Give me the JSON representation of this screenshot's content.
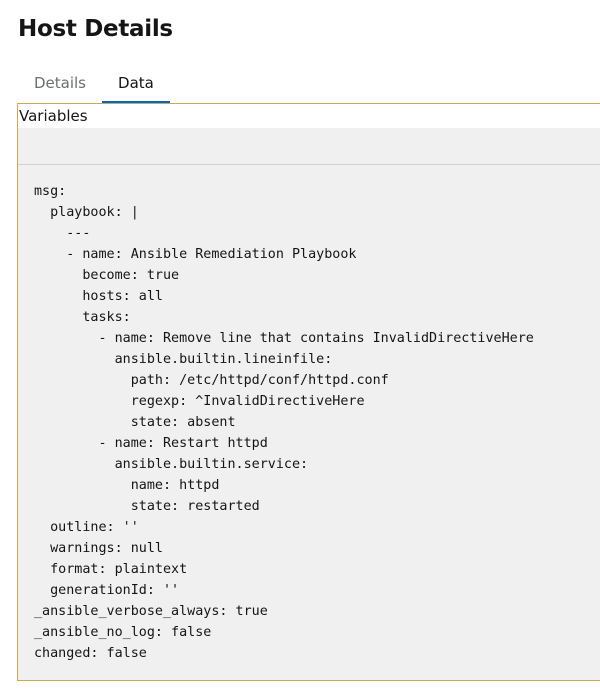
{
  "page": {
    "title": "Host Details"
  },
  "tabs": [
    {
      "label": "Details",
      "active": false
    },
    {
      "label": "Data",
      "active": true
    }
  ],
  "editor": {
    "label": "Variables",
    "lines": [
      "msg:",
      "  playbook: |",
      "    ---",
      "    - name: Ansible Remediation Playbook",
      "      become: true",
      "      hosts: all",
      "      tasks:",
      "        - name: Remove line that contains InvalidDirectiveHere",
      "          ansible.builtin.lineinfile:",
      "            path: /etc/httpd/conf/httpd.conf",
      "            regexp: ^InvalidDirectiveHere",
      "            state: absent",
      "        - name: Restart httpd",
      "          ansible.builtin.service:",
      "            name: httpd",
      "            state: restarted",
      "  outline: ''",
      "  warnings: null",
      "  format: plaintext",
      "  generationId: ''",
      "_ansible_verbose_always: true",
      "_ansible_no_log: false",
      "changed: false"
    ]
  },
  "colors": {
    "accent": "#0066cc",
    "panel_border": "#c9a85b",
    "code_background": "#f0f0f0"
  }
}
